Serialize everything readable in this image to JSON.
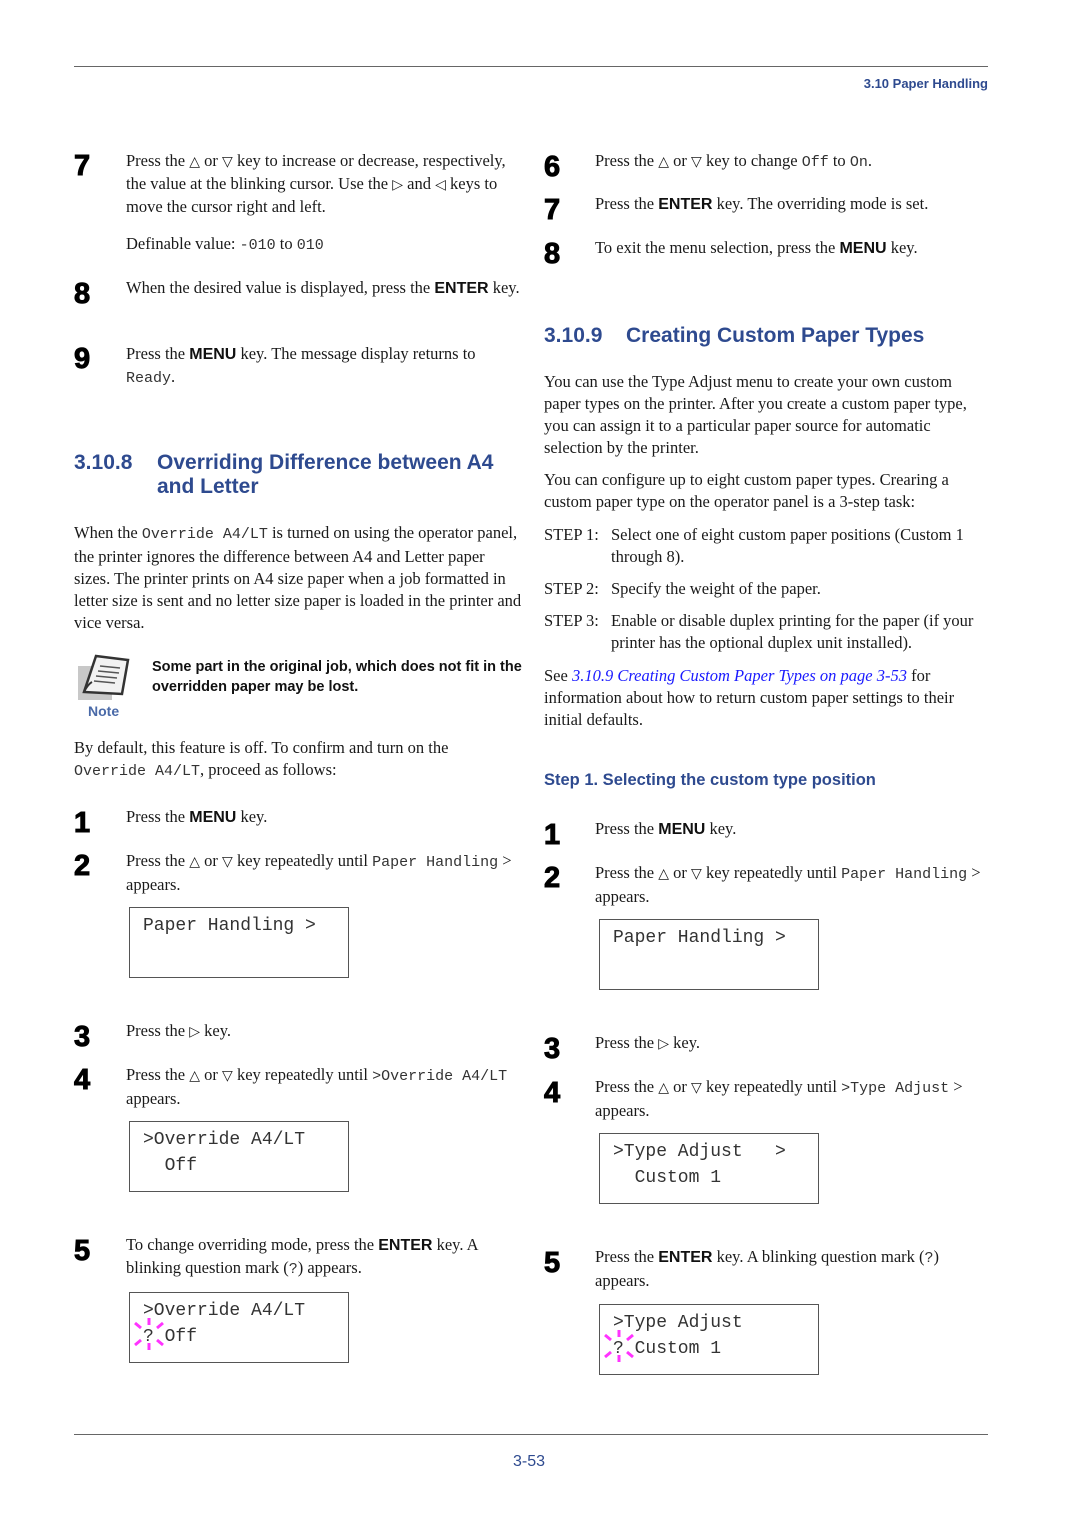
{
  "header": {
    "running_head": "3.10 Paper Handling"
  },
  "icons": {
    "up": "△",
    "down": "▽",
    "right": "▷",
    "left": "◁"
  },
  "left": {
    "steps_top": [
      {
        "num": "7",
        "pre": "Press the ",
        "mid1": " or ",
        "post1": " key to increase or decrease, respectively, the value at the blinking cursor. Use the ",
        "and": " and ",
        "post2": " keys to move the cursor right and left.",
        "def_label": "Definable value: ",
        "def_from": "-010",
        "def_to_word": " to ",
        "def_to": "010"
      },
      {
        "num": "8",
        "text": "When the desired value is displayed, press the ",
        "key": "ENTER",
        "post": " key."
      },
      {
        "num": "9",
        "pre": "Press the ",
        "key": "MENU",
        "post": " key. The message display returns to ",
        "mono": "Ready",
        "end": "."
      }
    ],
    "section": {
      "number": "3.10.8",
      "title_line1": "Overriding Difference between A4",
      "title_line2": "and Letter",
      "para1_pre": "When the ",
      "para1_mono": "Override A4/LT",
      "para1_post": " is turned on using the operator panel, the printer ignores the difference between A4 and Letter paper sizes. The printer prints on A4 size paper when a job formatted in letter size is sent and no letter size paper is loaded in the printer and vice versa.",
      "note_text": "Some part in the original job, which does not fit in the overridden paper may be lost.",
      "note_label": "Note",
      "para2_pre": "By default, this feature is off. To confirm and turn on the ",
      "para2_mono": "Override A4/LT",
      "para2_post": ", proceed as follows:"
    },
    "steps": [
      {
        "num": "1",
        "pre": "Press the ",
        "key": "MENU",
        "post": " key."
      },
      {
        "num": "2",
        "pre": "Press the ",
        "mid": " or ",
        "post": " key repeatedly until ",
        "mono": "Paper Handling",
        "end": " > appears."
      },
      {
        "num": "3",
        "pre": "Press the ",
        "post": " key."
      },
      {
        "num": "4",
        "pre": "Press the ",
        "mid": " or ",
        "post": " key repeatedly until ",
        "mono": ">Override A4/LT",
        "end": " appears."
      },
      {
        "num": "5",
        "pre": "To change overriding mode, press the ",
        "key": "ENTER",
        "post": " key. A blinking question mark (",
        "mono": "?",
        "end": ") appears."
      }
    ],
    "lcd": [
      {
        "line1": "Paper Handling >",
        "line2": ""
      },
      {
        "line1": ">Override A4/LT",
        "line2": "  Off"
      },
      {
        "line1": ">Override A4/LT",
        "line2": "? Off"
      }
    ]
  },
  "right": {
    "steps_top": [
      {
        "num": "6",
        "pre": "Press the ",
        "mid": " or ",
        "post": " key to change ",
        "mono1": "Off",
        "to": " to ",
        "mono2": "On",
        "end": "."
      },
      {
        "num": "7",
        "pre": "Press the ",
        "key": "ENTER",
        "post": " key. The overriding mode is set."
      },
      {
        "num": "8",
        "pre": "To exit the menu selection, press the ",
        "key": "MENU",
        "post": " key."
      }
    ],
    "section": {
      "number": "3.10.9",
      "title": "Creating Custom Paper Types",
      "para1": "You can use the Type Adjust menu to create your own custom paper types on the printer. After you create a custom paper type, you can assign it to a particular paper source for automatic selection by the printer.",
      "para2": "You can configure up to eight custom paper types. Crearing a custom paper type on the operator panel is a 3-step task:",
      "task_steps": [
        {
          "label": "STEP 1:",
          "text": "Select one of eight custom paper positions (Custom 1 through 8)."
        },
        {
          "label": "STEP 2:",
          "text": "Specify the weight of the paper."
        },
        {
          "label": "STEP 3:",
          "text": "Enable or disable duplex printing for the paper (if your printer has the optional duplex unit installed)."
        }
      ],
      "see_pre": "See ",
      "see_link": "3.10.9 Creating Custom Paper Types on page 3-53",
      "see_post": " for information about how to return custom paper settings to their initial defaults.",
      "subheading": "Step 1. Selecting the custom type position"
    },
    "steps": [
      {
        "num": "1",
        "pre": "Press the ",
        "key": "MENU",
        "post": " key."
      },
      {
        "num": "2",
        "pre": "Press the ",
        "mid": " or ",
        "post": " key repeatedly until ",
        "mono": "Paper Handling",
        "end": " > appears."
      },
      {
        "num": "3",
        "pre": "Press the ",
        "post": " key."
      },
      {
        "num": "4",
        "pre": "Press the ",
        "mid": " or ",
        "post": " key repeatedly until ",
        "mono": ">Type Adjust",
        "end": " > appears."
      },
      {
        "num": "5",
        "pre": "Press the ",
        "key": "ENTER",
        "post": " key. A blinking question mark (",
        "mono": "?",
        "end": ") appears."
      }
    ],
    "lcd": [
      {
        "line1": "Paper Handling >",
        "line2": ""
      },
      {
        "line1": ">Type Adjust   >",
        "line2": "  Custom 1"
      },
      {
        "line1": ">Type Adjust",
        "line2": "? Custom 1"
      }
    ]
  },
  "footer": {
    "page_number": "3-53"
  },
  "colors": {
    "heading": "#2e4a8f",
    "link": "#1a1aff",
    "blink": "#ff33ff"
  }
}
